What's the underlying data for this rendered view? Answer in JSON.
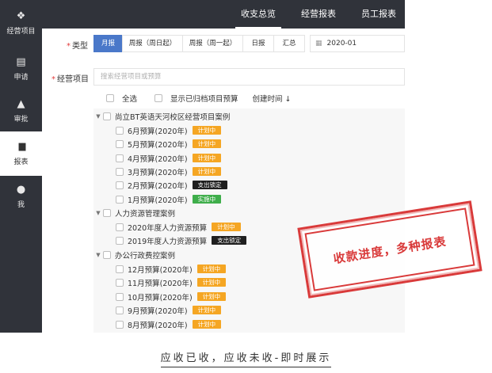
{
  "sidebar": {
    "items": [
      {
        "label": "经营项目",
        "icon": "layers-icon",
        "glyph": "❖"
      },
      {
        "label": "申请",
        "icon": "document-icon",
        "glyph": "▤"
      },
      {
        "label": "审批",
        "icon": "user-check-icon",
        "glyph": "▲"
      },
      {
        "label": "报表",
        "icon": "bar-chart-icon",
        "glyph": "▮▮"
      },
      {
        "label": "我",
        "icon": "user-icon",
        "glyph": "●"
      }
    ],
    "active_index": 3
  },
  "topbar": {
    "tabs": [
      "收支总览",
      "经营报表",
      "员工报表"
    ],
    "active_index": 0
  },
  "filter": {
    "type_label": "类型",
    "type_options": [
      "月报",
      "周报（周日起）",
      "周报（周一起）",
      "日报",
      "汇总"
    ],
    "type_active_index": 0,
    "date_value": "2020-01",
    "project_label": "经营项目",
    "search_placeholder": "搜索经营项目或预算"
  },
  "options": {
    "select_all": "全选",
    "show_archived": "显示已归档项目预算",
    "sort_label": "创建时间 ↓"
  },
  "groups": [
    {
      "name": "尚立BT英语天河校区经营项目案例",
      "items": [
        {
          "label": "6月预算(2020年)",
          "status": "计划中"
        },
        {
          "label": "5月预算(2020年)",
          "status": "计划中"
        },
        {
          "label": "4月预算(2020年)",
          "status": "计划中"
        },
        {
          "label": "3月预算(2020年)",
          "status": "计划中"
        },
        {
          "label": "2月预算(2020年)",
          "status": "支出锁定"
        },
        {
          "label": "1月预算(2020年)",
          "status": "实施中"
        }
      ]
    },
    {
      "name": "人力资源管理案例",
      "items": [
        {
          "label": "2020年度人力资源预算",
          "status": "计划中"
        },
        {
          "label": "2019年度人力资源预算",
          "status": "支出锁定"
        }
      ]
    },
    {
      "name": "办公行政费控案例",
      "items": [
        {
          "label": "12月预算(2020年)",
          "status": "计划中"
        },
        {
          "label": "11月预算(2020年)",
          "status": "计划中"
        },
        {
          "label": "10月预算(2020年)",
          "status": "计划中"
        },
        {
          "label": "9月预算(2020年)",
          "status": "计划中"
        },
        {
          "label": "8月预算(2020年)",
          "status": "计划中"
        }
      ]
    }
  ],
  "status_colors": {
    "计划中": "#f5a623",
    "支出锁定": "#1f1f1f",
    "实施中": "#3fae4b"
  },
  "stamp_text": "收款进度，多种报表",
  "caption": "应收已收，应收未收-即时展示"
}
